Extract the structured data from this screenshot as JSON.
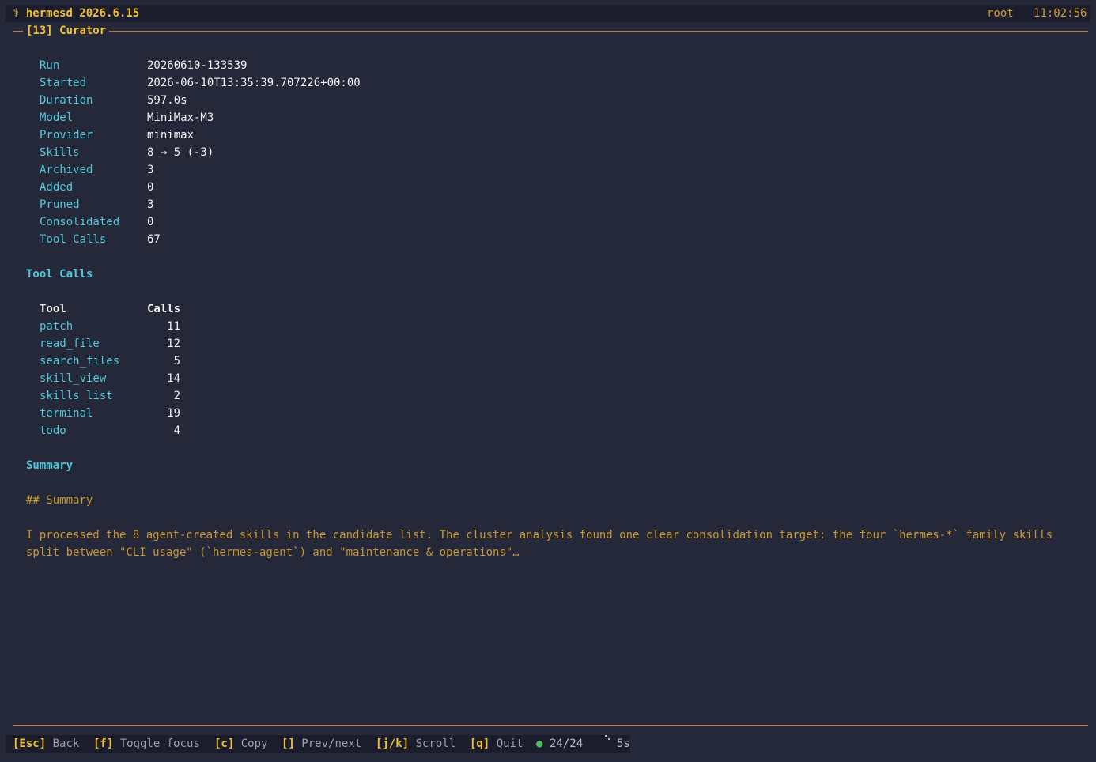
{
  "app": {
    "icon": "⚕",
    "title": "hermesd 2026.6.15",
    "user": "root",
    "time": "11:02:56"
  },
  "panel": {
    "title": "[13] Curator"
  },
  "details": [
    {
      "label": "Run",
      "value": "20260610-133539"
    },
    {
      "label": "Started",
      "value": "2026-06-10T13:35:39.707226+00:00"
    },
    {
      "label": "Duration",
      "value": "597.0s"
    },
    {
      "label": "Model",
      "value": "MiniMax-M3"
    },
    {
      "label": "Provider",
      "value": "minimax"
    },
    {
      "label": "Skills",
      "value": "8 → 5 (-3)"
    },
    {
      "label": "Archived",
      "value": "3"
    },
    {
      "label": "Added",
      "value": "0"
    },
    {
      "label": "Pruned",
      "value": "3"
    },
    {
      "label": "Consolidated",
      "value": "0"
    },
    {
      "label": "Tool Calls",
      "value": "67"
    }
  ],
  "tool_calls": {
    "heading": "Tool Calls",
    "col_tool": "Tool",
    "col_calls": "Calls",
    "rows": [
      {
        "tool": "patch",
        "calls": "11"
      },
      {
        "tool": "read_file",
        "calls": "12"
      },
      {
        "tool": "search_files",
        "calls": "5"
      },
      {
        "tool": "skill_view",
        "calls": "14"
      },
      {
        "tool": "skills_list",
        "calls": "2"
      },
      {
        "tool": "terminal",
        "calls": "19"
      },
      {
        "tool": "todo",
        "calls": "4"
      }
    ]
  },
  "summary": {
    "heading": "Summary",
    "md_heading": "## Summary",
    "line1": "I processed the 8 agent-created skills in the candidate list. The cluster analysis found one clear consolidation target: the four `hermes-*` family skills",
    "line2": "split between \"CLI usage\" (`hermes-agent`) and \"maintenance & operations\"…"
  },
  "footer": {
    "esc_key": "[Esc]",
    "esc_label": "Back",
    "f_key": "[f]",
    "f_label": "Toggle focus",
    "c_key": "[c]",
    "c_label": "Copy",
    "nav_key": "[]",
    "nav_label": "Prev/next",
    "jk_key": "[j/k]",
    "jk_label": "Scroll",
    "q_key": "[q]",
    "q_label": "Quit",
    "status_dot": "●",
    "status_count": "24/24",
    "spinner": "⠑",
    "interval": "5s"
  },
  "colors": {
    "background": "#252838",
    "bar": "#1b1d2c",
    "accent": "#f0c030",
    "teal": "#4ec9dc",
    "rule": "#c07a35",
    "ok": "#4cbb5e"
  }
}
